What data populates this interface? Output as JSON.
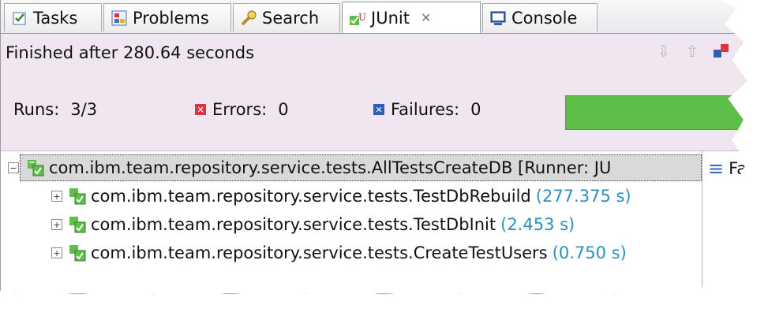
{
  "tabs": [
    {
      "label": "Tasks",
      "icon": "tasks-icon"
    },
    {
      "label": "Problems",
      "icon": "problems-icon"
    },
    {
      "label": "Search",
      "icon": "search-icon"
    },
    {
      "label": "JUnit",
      "icon": "junit-icon",
      "active": true
    },
    {
      "label": "Console",
      "icon": "console-icon"
    }
  ],
  "status": {
    "text": "Finished after 280.64 seconds"
  },
  "counters": {
    "runs_label": "Runs:",
    "runs_value": "3/3",
    "errors_label": "Errors:",
    "errors_value": "0",
    "failures_label": "Failures:",
    "failures_value": "0"
  },
  "progress": {
    "fraction": 1.0,
    "color": "#5dbf4a"
  },
  "tree": {
    "root": {
      "name": "com.ibm.team.repository.service.tests.AllTestsCreateDB [Runner: JU"
    },
    "children": [
      {
        "name": "com.ibm.team.repository.service.tests.TestDbRebuild",
        "time": "(277.375 s)"
      },
      {
        "name": "com.ibm.team.repository.service.tests.TestDbInit",
        "time": "(2.453 s)"
      },
      {
        "name": "com.ibm.team.repository.service.tests.CreateTestUsers",
        "time": "(0.750 s)"
      }
    ]
  },
  "right_pane": {
    "label": "Fa"
  },
  "colors": {
    "accent": "#2b8fbf",
    "error": "#d9363e",
    "failure": "#2f5fb0",
    "toolbar_bg": "#efe6ef"
  }
}
